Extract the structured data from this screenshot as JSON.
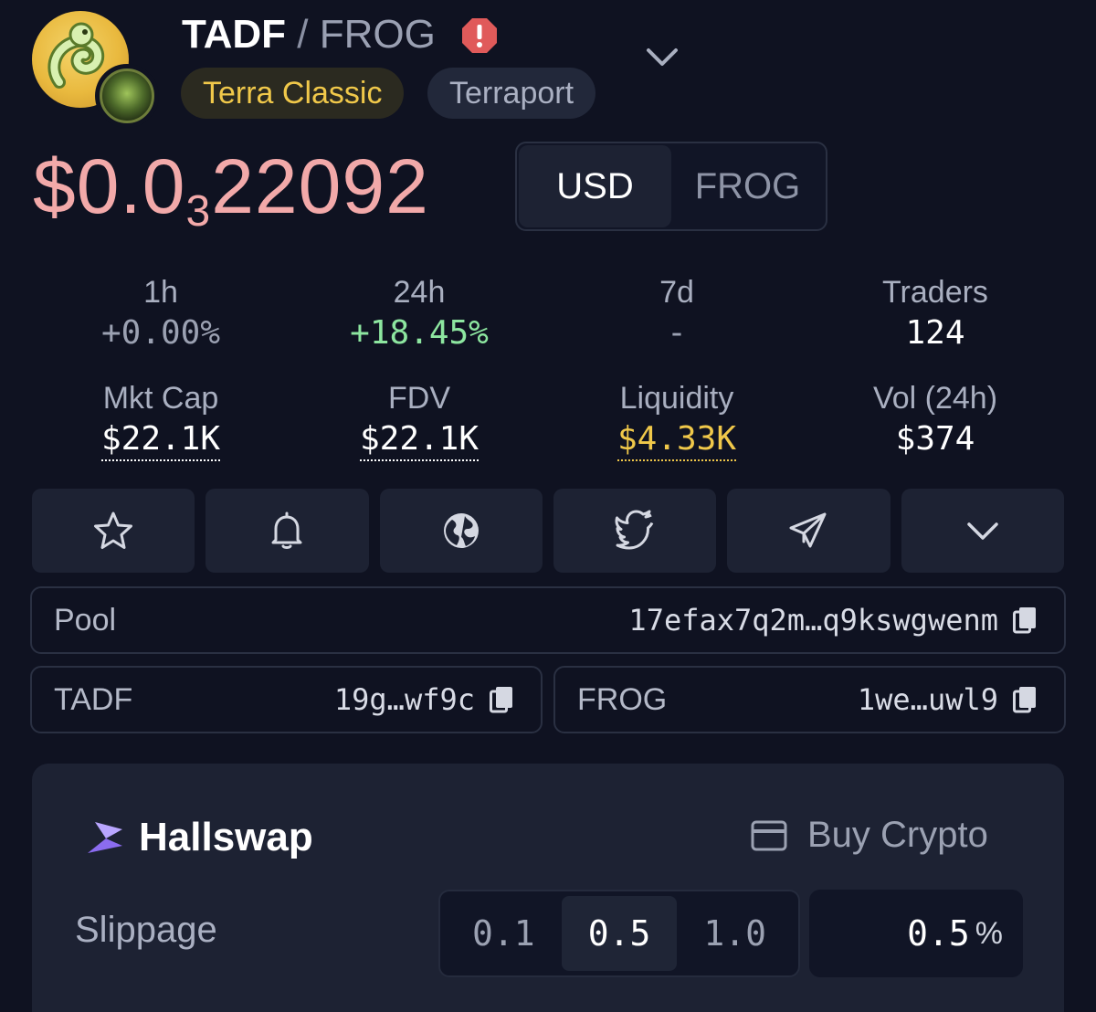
{
  "header": {
    "base_symbol": "TADF",
    "separator": "/",
    "quote_symbol": "FROG",
    "warning_icon": "alert-octagon-icon",
    "chain_tag": "Terra Classic",
    "dex_tag": "Terraport",
    "expand_icon": "chevron-down-icon"
  },
  "price": {
    "prefix": "$0.0",
    "zero_count": "3",
    "digits": "22092",
    "currency_options": [
      "USD",
      "FROG"
    ],
    "selected_currency": "USD"
  },
  "stats": {
    "change_1h": {
      "label": "1h",
      "value": "+0.00%"
    },
    "change_24h": {
      "label": "24h",
      "value": "+18.45%"
    },
    "change_7d": {
      "label": "7d",
      "value": "-"
    },
    "traders": {
      "label": "Traders",
      "value": "124"
    },
    "mkt_cap": {
      "label": "Mkt Cap",
      "value": "$22.1K"
    },
    "fdv": {
      "label": "FDV",
      "value": "$22.1K"
    },
    "liquidity": {
      "label": "Liquidity",
      "value": "$4.33K"
    },
    "volume_24h": {
      "label": "Vol (24h)",
      "value": "$374"
    }
  },
  "actions": [
    "star-icon",
    "bell-icon",
    "globe-icon",
    "twitter-icon",
    "telegram-icon",
    "chevron-down-icon"
  ],
  "addresses": {
    "pool": {
      "label": "Pool",
      "value": "17efax7q2m…q9kswgwenm"
    },
    "base": {
      "label": "TADF",
      "value": "19g…wf9c"
    },
    "quote": {
      "label": "FROG",
      "value": "1we…uwl9"
    }
  },
  "swap": {
    "title": "Hallswap",
    "buy_label": "Buy Crypto",
    "slippage_label": "Slippage",
    "slippage_options": [
      "0.1",
      "0.5",
      "1.0"
    ],
    "selected_slippage": "0.5",
    "custom_value": "0.5",
    "custom_unit": "%"
  },
  "colors": {
    "background": "#0f1221",
    "panel": "#1d2233",
    "price": "#f2a9a9",
    "positive": "#8de6a0",
    "chain_tag": "#f0c84a",
    "liquidity": "#f0c84a"
  }
}
